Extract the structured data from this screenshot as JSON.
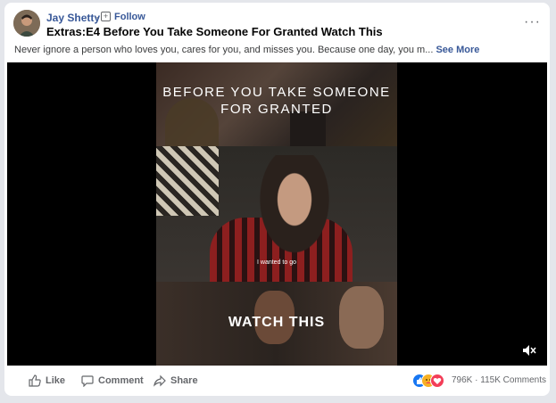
{
  "post": {
    "author": "Jay Shetty",
    "separator": "·",
    "follow_label": "Follow",
    "title": "Extras:E4 Before You Take Someone For Granted Watch This",
    "description": "Never ignore a person who loves you, cares for you, and misses you. Because one day, you m...",
    "see_more_label": "See More",
    "more_label": "···"
  },
  "video": {
    "overlay_title_line1": "BEFORE YOU TAKE SOMEONE",
    "overlay_title_line2": "FOR GRANTED",
    "caption": "I wanted to go",
    "overlay_bottom": "WATCH THIS",
    "muted": true
  },
  "actions": {
    "like_label": "Like",
    "comment_label": "Comment",
    "share_label": "Share"
  },
  "engagement": {
    "reactions_count": "796K",
    "dot": "·",
    "comments_count": "115K Comments",
    "reaction_icons": [
      "like-icon",
      "care-icon",
      "love-icon"
    ]
  },
  "colors": {
    "link": "#385898",
    "like_reaction": "#1877f2",
    "care_reaction": "#f7b125",
    "love_reaction": "#f33e58"
  }
}
